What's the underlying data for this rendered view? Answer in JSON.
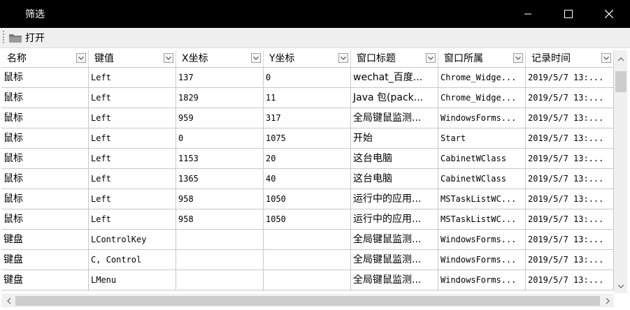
{
  "window": {
    "title": "筛选"
  },
  "toolbar": {
    "open_label": "打开",
    "open_icon": "folder-icon"
  },
  "table": {
    "columns": [
      "名称",
      "键值",
      "X坐标",
      "Y坐标",
      "窗口标题",
      "窗口所属",
      "记录时间"
    ],
    "rows": [
      [
        "鼠标",
        "Left",
        "137",
        "0",
        "wechat_百度...",
        "Chrome_Widge...",
        "2019/5/7 13:..."
      ],
      [
        "鼠标",
        "Left",
        "1829",
        "11",
        "Java 包(pack...",
        "Chrome_Widge...",
        "2019/5/7 13:..."
      ],
      [
        "鼠标",
        "Left",
        "959",
        "317",
        "全局键鼠监测...",
        "WindowsForms...",
        "2019/5/7 13:..."
      ],
      [
        "鼠标",
        "Left",
        "0",
        "1075",
        "开始",
        "Start",
        "2019/5/7 13:..."
      ],
      [
        "鼠标",
        "Left",
        "1153",
        "20",
        "这台电脑",
        "CabinetWClass",
        "2019/5/7 13:..."
      ],
      [
        "鼠标",
        "Left",
        "1365",
        "40",
        "这台电脑",
        "CabinetWClass",
        "2019/5/7 13:..."
      ],
      [
        "鼠标",
        "Left",
        "958",
        "1050",
        "运行中的应用...",
        "MSTaskListWC...",
        "2019/5/7 13:..."
      ],
      [
        "鼠标",
        "Left",
        "958",
        "1050",
        "运行中的应用...",
        "MSTaskListWC...",
        "2019/5/7 13:..."
      ],
      [
        "键盘",
        "LControlKey",
        "",
        "",
        "全局键鼠监测...",
        "WindowsForms...",
        "2019/5/7 13:..."
      ],
      [
        "键盘",
        "C, Control",
        "",
        "",
        "全局键鼠监测...",
        "WindowsForms...",
        "2019/5/7 13:..."
      ],
      [
        "键盘",
        "LMenu",
        "",
        "",
        "全局键鼠监测...",
        "WindowsForms...",
        "2019/5/7 13:..."
      ]
    ]
  }
}
